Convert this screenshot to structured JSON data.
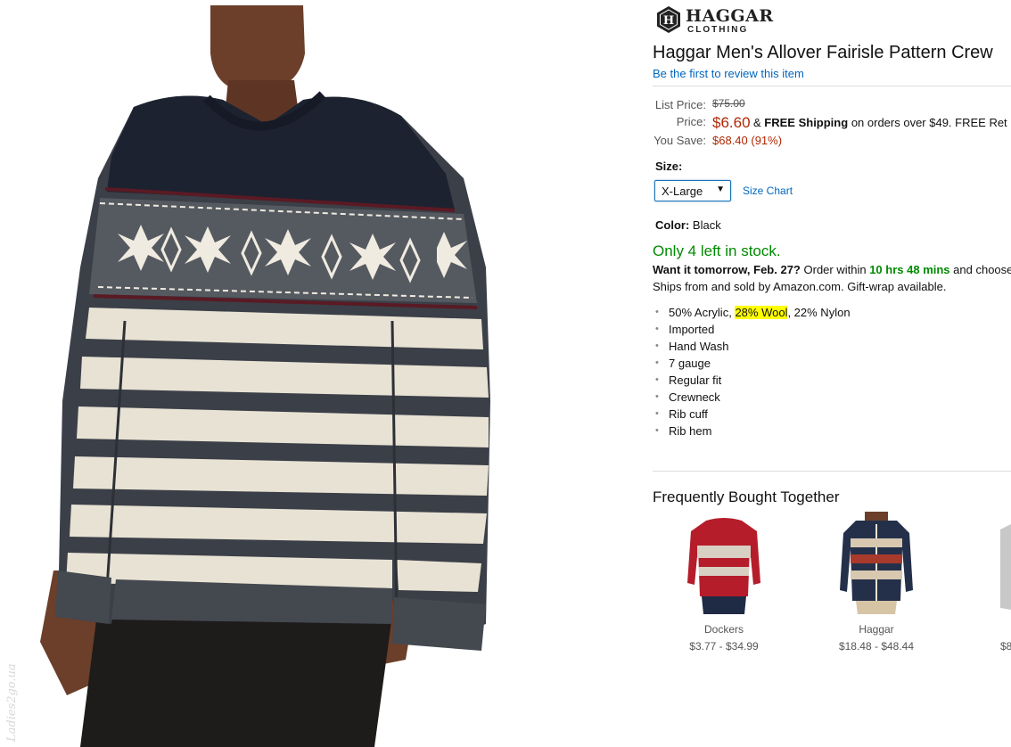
{
  "watermark": "Ladies2go.ua",
  "brand": {
    "name": "HAGGAR",
    "sub": "CLOTHING",
    "mark_letter": "H"
  },
  "product": {
    "title": "Haggar Men's Allover Fairisle Pattern Crew",
    "review_link": "Be the first to review this item"
  },
  "pricing": {
    "list_price_label": "List Price:",
    "list_price": "$75.00",
    "price_label": "Price:",
    "price": "$6.60",
    "shipping_prefix": "&",
    "shipping_bold": "FREE Shipping",
    "shipping_suffix": "on orders over $49. FREE Ret",
    "you_save_label": "You Save:",
    "you_save": "$68.40 (91%)"
  },
  "size": {
    "label": "Size:",
    "selected": "X-Large",
    "chart_link": "Size Chart"
  },
  "color": {
    "label": "Color:",
    "value": "Black"
  },
  "availability": {
    "stock": "Only 4 left in stock.",
    "want_it": "Want it tomorrow, Feb. 27?",
    "order_within": "Order within",
    "time_left": "10 hrs 48 mins",
    "and_choose": "and choose",
    "ships_from": "Ships from and sold by Amazon.com. Gift-wrap available."
  },
  "features": {
    "material_a": "50% Acrylic,",
    "material_highlight": "28% Wool",
    "material_b": ", 22% Nylon",
    "items": [
      "Imported",
      "Hand Wash",
      "7 gauge",
      "Regular fit",
      "Crewneck",
      "Rib cuff",
      "Rib hem"
    ]
  },
  "fbt": {
    "title": "Frequently Bought Together",
    "items": [
      {
        "brand": "Dockers",
        "price": "$3.77 - $34.99"
      },
      {
        "brand": "Haggar",
        "price": "$18.48 - $48.44"
      },
      {
        "brand": "",
        "price": "$8"
      }
    ]
  },
  "colors": {
    "link": "#0066c0",
    "price": "#b12704",
    "in_stock": "#008a00",
    "highlight": "#ffff00"
  }
}
